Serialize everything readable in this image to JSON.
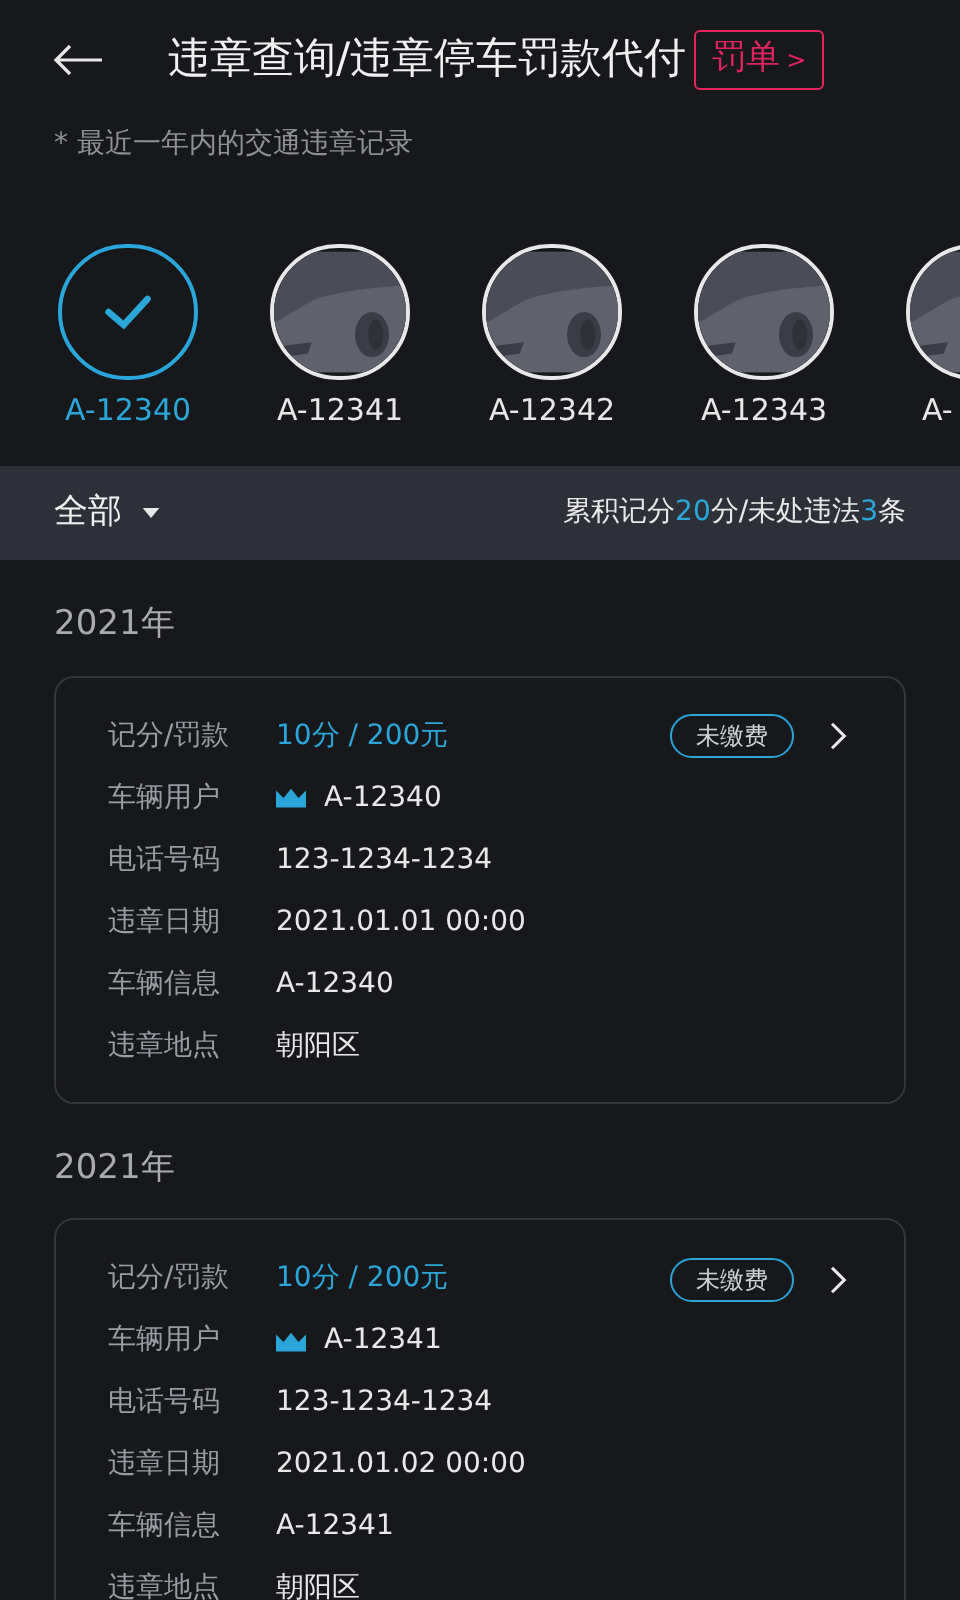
{
  "header": {
    "title": "违章查询/违章停车罚款代付",
    "action": "罚单",
    "action_arrow": ">"
  },
  "note": "* 最近一年内的交通违章记录",
  "vehicles": [
    {
      "plate": "A-12340",
      "selected": true
    },
    {
      "plate": "A-12341",
      "selected": false
    },
    {
      "plate": "A-12342",
      "selected": false
    },
    {
      "plate": "A-12343",
      "selected": false
    },
    {
      "plate": "A-",
      "selected": false
    }
  ],
  "filter": {
    "label": "全部",
    "summary": [
      {
        "text": "累积记分",
        "highlight": false
      },
      {
        "text": "20",
        "highlight": true
      },
      {
        "text": "分/未处违法",
        "highlight": false
      },
      {
        "text": "3",
        "highlight": true
      },
      {
        "text": "条",
        "highlight": false
      }
    ]
  },
  "records": [
    {
      "year": "2021年",
      "status": "未缴费",
      "rows": [
        {
          "kind": "fine",
          "label": "记分/罚款",
          "value": "10分 / 200元"
        },
        {
          "kind": "owner",
          "label": "车辆用户",
          "value": "A-12340"
        },
        {
          "kind": "plain",
          "label": "电话号码",
          "value": "123-1234-1234"
        },
        {
          "kind": "plain",
          "label": "违章日期",
          "value": "2021.01.01 00:00"
        },
        {
          "kind": "plain",
          "label": "车辆信息",
          "value": "A-12340"
        },
        {
          "kind": "plain",
          "label": "违章地点",
          "value": "朝阳区"
        }
      ]
    },
    {
      "year": "2021年",
      "status": "未缴费",
      "rows": [
        {
          "kind": "fine",
          "label": "记分/罚款",
          "value": "10分 / 200元"
        },
        {
          "kind": "owner",
          "label": "车辆用户",
          "value": "A-12341"
        },
        {
          "kind": "plain",
          "label": "电话号码",
          "value": "123-1234-1234"
        },
        {
          "kind": "plain",
          "label": "违章日期",
          "value": "2021.01.02 00:00"
        },
        {
          "kind": "plain",
          "label": "车辆信息",
          "value": "A-12341"
        },
        {
          "kind": "plain",
          "label": "违章地点",
          "value": "朝阳区"
        }
      ]
    }
  ]
}
